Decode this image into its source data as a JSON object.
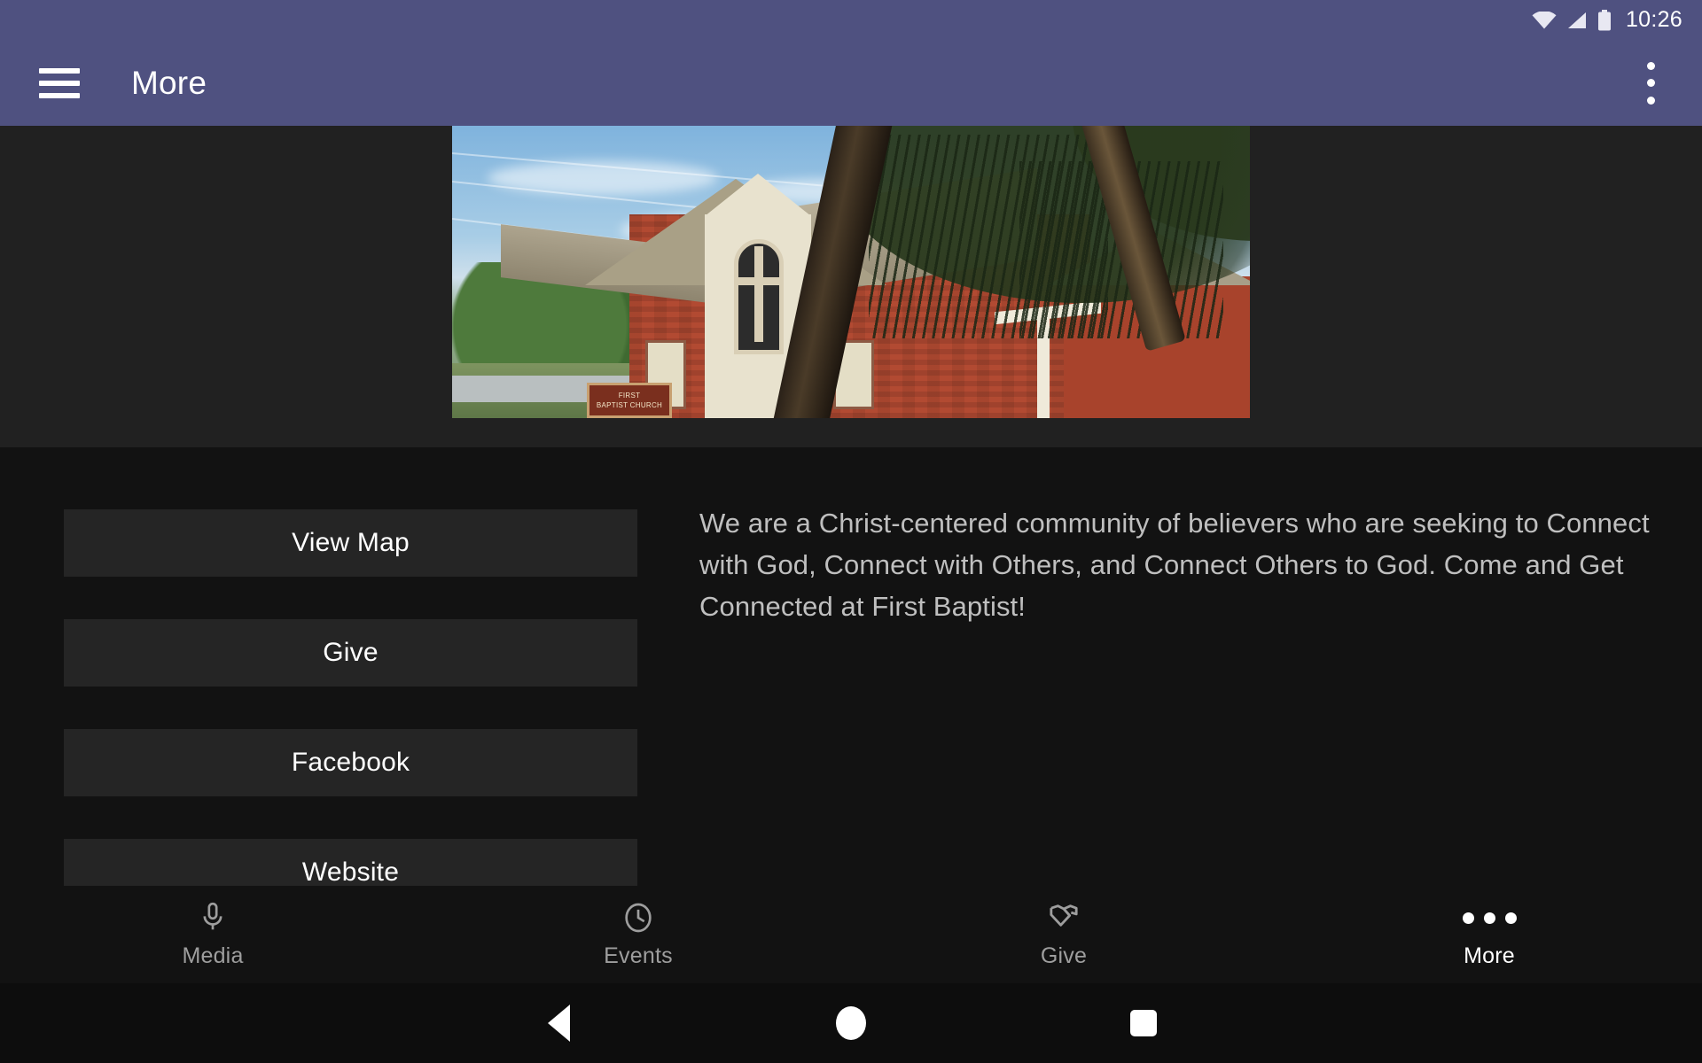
{
  "status_bar": {
    "time": "10:26",
    "icons": [
      "wifi-icon",
      "cellular-signal-icon",
      "battery-icon"
    ]
  },
  "app_bar": {
    "menu_icon": "hamburger-menu-icon",
    "title": "More",
    "overflow_icon": "overflow-menu-icon",
    "background_color": "#4F5180"
  },
  "hero": {
    "image_alt": "First Baptist Church building photo",
    "band_color": "#212121",
    "sign_line1": "FIRST",
    "sign_line2": "BAPTIST CHURCH"
  },
  "main": {
    "buttons": [
      {
        "label": "View Map"
      },
      {
        "label": "Give"
      },
      {
        "label": "Facebook"
      },
      {
        "label": "Website"
      }
    ],
    "description": "We are a Christ-centered community of believers who are seeking to Connect with God, Connect with Others, and Connect Others to God.  Come and Get Connected at First Baptist!",
    "background_color": "#121212",
    "button_color": "#252525"
  },
  "tab_bar": {
    "tabs": [
      {
        "label": "Media",
        "icon": "microphone-icon",
        "active": false
      },
      {
        "label": "Events",
        "icon": "clock-icon",
        "active": false
      },
      {
        "label": "Give",
        "icon": "heart-hand-icon",
        "active": false
      },
      {
        "label": "More",
        "icon": "ellipsis-icon",
        "active": true
      }
    ],
    "active_color": "#FFFFFF",
    "inactive_color": "#9E9E9E"
  },
  "system_nav": {
    "buttons": [
      {
        "name": "back-button",
        "icon": "triangle-left-icon"
      },
      {
        "name": "home-button",
        "icon": "circle-icon"
      },
      {
        "name": "recents-button",
        "icon": "square-icon"
      }
    ]
  }
}
